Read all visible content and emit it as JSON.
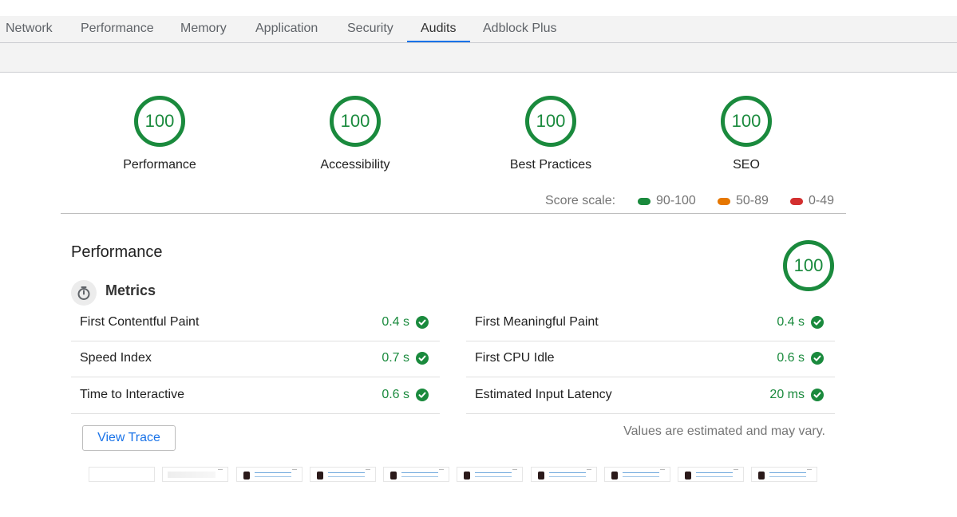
{
  "tabs": [
    {
      "label": "Network"
    },
    {
      "label": "Performance"
    },
    {
      "label": "Memory"
    },
    {
      "label": "Application"
    },
    {
      "label": "Security"
    },
    {
      "label": "Audits",
      "active": true
    },
    {
      "label": "Adblock Plus"
    }
  ],
  "gauges": [
    {
      "score": "100",
      "label": "Performance"
    },
    {
      "score": "100",
      "label": "Accessibility"
    },
    {
      "score": "100",
      "label": "Best Practices"
    },
    {
      "score": "100",
      "label": "SEO"
    }
  ],
  "score_scale": {
    "label": "Score scale:",
    "ranges": [
      {
        "label": "90-100",
        "color": "#1a8a3d"
      },
      {
        "label": "50-89",
        "color": "#e67700"
      },
      {
        "label": "0-49",
        "color": "#d32f2f"
      }
    ]
  },
  "performance": {
    "title": "Performance",
    "score": "100",
    "metrics_title": "Metrics",
    "metrics": [
      {
        "label": "First Contentful Paint",
        "value": "0.4 s"
      },
      {
        "label": "First Meaningful Paint",
        "value": "0.4 s"
      },
      {
        "label": "Speed Index",
        "value": "0.7 s"
      },
      {
        "label": "First CPU Idle",
        "value": "0.6 s"
      },
      {
        "label": "Time to Interactive",
        "value": "0.6 s"
      },
      {
        "label": "Estimated Input Latency",
        "value": "20 ms"
      }
    ],
    "view_trace_label": "View Trace",
    "note": "Values are estimated and may vary."
  },
  "colors": {
    "pass": "#1a8a3d",
    "accent": "#1a73e8"
  },
  "filmstrip": {
    "frame_count": 10
  }
}
